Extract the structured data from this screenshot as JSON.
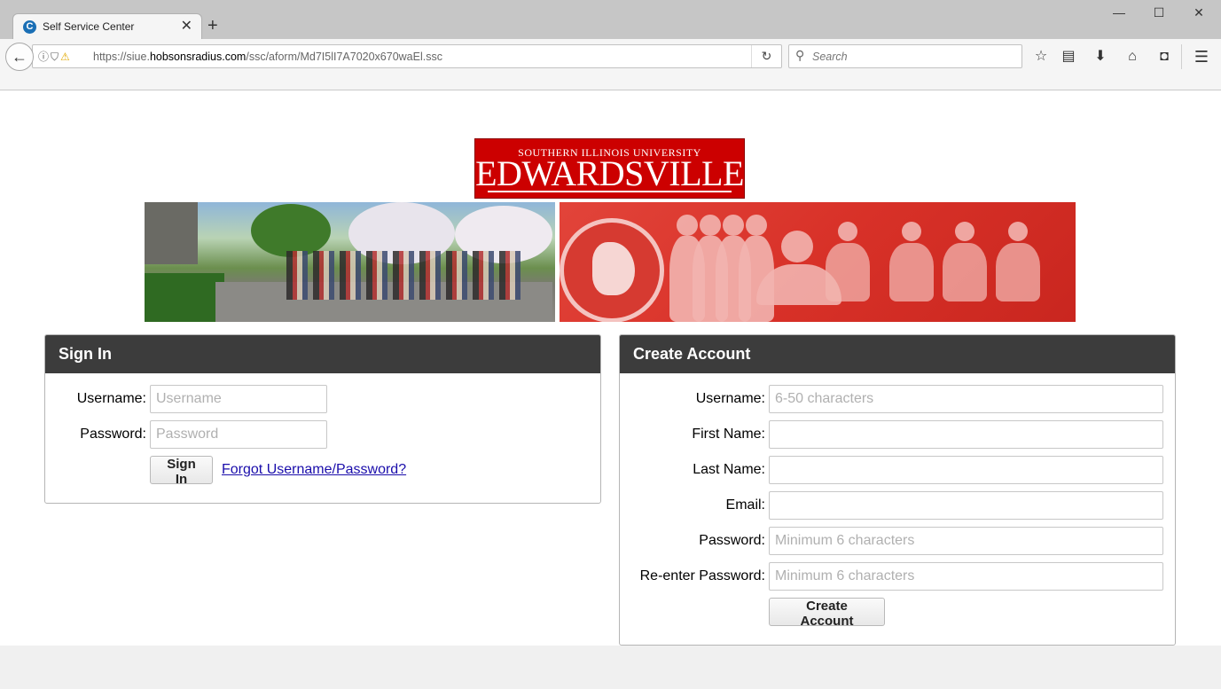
{
  "browser": {
    "tab_title": "Self Service Center",
    "tab_favicon": "C",
    "url_prefix": "https://siue.",
    "url_host": "hobsonsradius.com",
    "url_path": "/ssc/aform/Md7I5lI7A7020x670waEl.ssc",
    "search_placeholder": "Search"
  },
  "logo": {
    "top_text": "SOUTHERN ILLINOIS UNIVERSITY",
    "main_text": "EDWARDSVILLE"
  },
  "signin": {
    "title": "Sign In",
    "username_label": "Username:",
    "username_placeholder": "Username",
    "password_label": "Password:",
    "password_placeholder": "Password",
    "submit_label": "Sign In",
    "forgot_link": "Forgot Username/Password?"
  },
  "create": {
    "title": "Create Account",
    "fields": [
      {
        "label": "Username:",
        "placeholder": "6-50 characters"
      },
      {
        "label": "First Name:",
        "placeholder": ""
      },
      {
        "label": "Last Name:",
        "placeholder": ""
      },
      {
        "label": "Email:",
        "placeholder": ""
      },
      {
        "label": "Password:",
        "placeholder": "Minimum 6 characters"
      },
      {
        "label": "Re-enter Password:",
        "placeholder": "Minimum 6 characters"
      }
    ],
    "submit_label": "Create Account"
  },
  "colors": {
    "panel_header": "#3c3c3c",
    "brand_red": "#cc0000",
    "link": "#1a0dab"
  },
  "icons": {
    "back": "arrow-left-icon",
    "info": "info-icon",
    "shield": "shield-icon",
    "warning": "lock-warning-icon",
    "reload": "reload-icon",
    "search": "search-icon",
    "bookmark": "star-icon",
    "reader": "reading-list-icon",
    "download": "download-icon",
    "home": "home-icon",
    "pocket": "pocket-icon",
    "menu": "hamburger-menu-icon"
  }
}
